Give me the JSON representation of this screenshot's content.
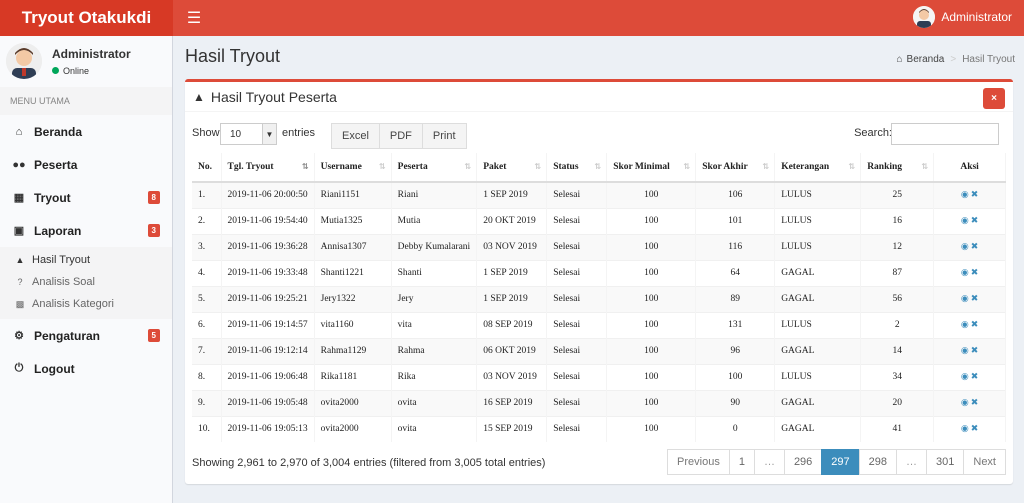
{
  "app": {
    "title": "Tryout Otakukdi",
    "menu_icon": "hamburger-icon"
  },
  "header": {
    "user": "Administrator"
  },
  "sidebar": {
    "user_name": "Administrator",
    "status": "Online",
    "menu_header": "MENU UTAMA",
    "items": [
      {
        "label": "Beranda",
        "icon": "home-icon"
      },
      {
        "label": "Peserta",
        "icon": "users-icon"
      },
      {
        "label": "Tryout",
        "icon": "calendar-icon",
        "badge": "8"
      },
      {
        "label": "Laporan",
        "icon": "laptop-icon",
        "badge": "3"
      },
      {
        "label": "Pengaturan",
        "icon": "gear-icon",
        "badge": "5"
      },
      {
        "label": "Logout",
        "icon": "power-icon"
      }
    ],
    "submenu": [
      {
        "label": "Hasil Tryout",
        "icon": "graduation-cap-icon"
      },
      {
        "label": "Analisis Soal",
        "icon": "question-icon"
      },
      {
        "label": "Analisis Kategori",
        "icon": "sitemap-icon"
      }
    ]
  },
  "page": {
    "title": "Hasil Tryout",
    "breadcrumb": [
      "Beranda",
      "Hasil Tryout"
    ]
  },
  "box": {
    "title": "Hasil Tryout Peserta",
    "close_label": "×",
    "show_label": "Show",
    "entries_value": "10",
    "entries_label": "entries",
    "buttons": [
      "Excel",
      "PDF",
      "Print"
    ],
    "search_label": "Search:",
    "search_value": ""
  },
  "table": {
    "columns": [
      "No.",
      "Tgl. Tryout",
      "Username",
      "Peserta",
      "Paket",
      "Status",
      "Skor Minimal",
      "Skor Akhir",
      "Keterangan",
      "Ranking",
      "Aksi"
    ],
    "rows": [
      [
        "1.",
        "2019-11-06 20:00:50",
        "Riani1151",
        "Riani",
        "1 SEP 2019",
        "Selesai",
        "100",
        "106",
        "LULUS",
        "25"
      ],
      [
        "2.",
        "2019-11-06 19:54:40",
        "Mutia1325",
        "Mutia",
        "20 OKT 2019",
        "Selesai",
        "100",
        "101",
        "LULUS",
        "16"
      ],
      [
        "3.",
        "2019-11-06 19:36:28",
        "Annisa1307",
        "Debby Kumalarani",
        "03 NOV 2019",
        "Selesai",
        "100",
        "116",
        "LULUS",
        "12"
      ],
      [
        "4.",
        "2019-11-06 19:33:48",
        "Shanti1221",
        "Shanti",
        "1 SEP 2019",
        "Selesai",
        "100",
        "64",
        "GAGAL",
        "87"
      ],
      [
        "5.",
        "2019-11-06 19:25:21",
        "Jery1322",
        "Jery",
        "1 SEP 2019",
        "Selesai",
        "100",
        "89",
        "GAGAL",
        "56"
      ],
      [
        "6.",
        "2019-11-06 19:14:57",
        "vita1160",
        "vita",
        "08 SEP 2019",
        "Selesai",
        "100",
        "131",
        "LULUS",
        "2"
      ],
      [
        "7.",
        "2019-11-06 19:12:14",
        "Rahma1129",
        "Rahma",
        "06 OKT 2019",
        "Selesai",
        "100",
        "96",
        "GAGAL",
        "14"
      ],
      [
        "8.",
        "2019-11-06 19:06:48",
        "Rika1181",
        "Rika",
        "03 NOV 2019",
        "Selesai",
        "100",
        "100",
        "LULUS",
        "34"
      ],
      [
        "9.",
        "2019-11-06 19:05:48",
        "ovita2000",
        "ovita",
        "16 SEP 2019",
        "Selesai",
        "100",
        "90",
        "GAGAL",
        "20"
      ],
      [
        "10.",
        "2019-11-06 19:05:13",
        "ovita2000",
        "ovita",
        "15 SEP 2019",
        "Selesai",
        "100",
        "0",
        "GAGAL",
        "41"
      ]
    ]
  },
  "footer": {
    "info": "Showing 2,961 to 2,970 of 3,004 entries (filtered from 3,005 total entries)",
    "pagination": [
      "Previous",
      "1",
      "…",
      "296",
      "297",
      "298",
      "…",
      "301",
      "Next"
    ],
    "active_page": "297"
  },
  "colors": {
    "brand": "#dd4b39",
    "brand_dark": "#d73925",
    "accent": "#3c8dbc",
    "online": "#00a65a"
  }
}
